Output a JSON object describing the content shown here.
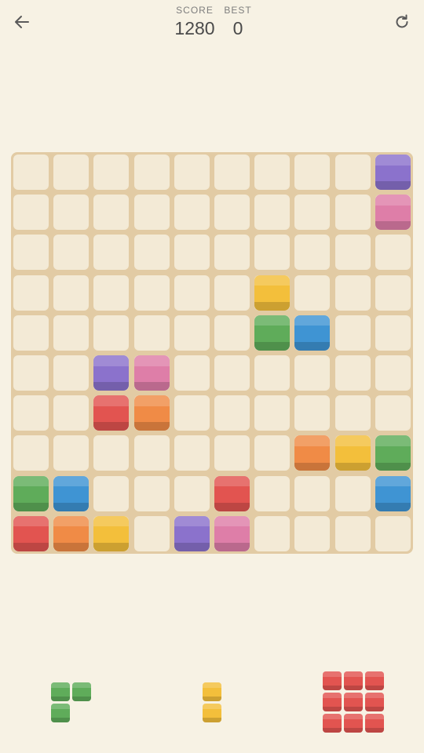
{
  "header": {
    "back_icon": "arrow-left-icon",
    "restart_icon": "restart-icon",
    "score_label": "SCORE",
    "score_value": "1280",
    "best_label": "BEST",
    "best_value": "0"
  },
  "colors": {
    "background": "#f7f2e4",
    "board": "#e2cba4",
    "empty_cell": "#f3ead6",
    "purple": "#8b72cc",
    "pink": "#de7ea8",
    "yellow": "#f3bf3b",
    "green": "#5fac5a",
    "blue": "#3f94d3",
    "red": "#e25450",
    "orange": "#f08b46"
  },
  "board": {
    "rows": 10,
    "cols": 10,
    "blocks": [
      {
        "row": 0,
        "col": 9,
        "color": "purple"
      },
      {
        "row": 1,
        "col": 9,
        "color": "pink"
      },
      {
        "row": 3,
        "col": 6,
        "color": "yellow"
      },
      {
        "row": 4,
        "col": 6,
        "color": "green"
      },
      {
        "row": 4,
        "col": 7,
        "color": "blue"
      },
      {
        "row": 5,
        "col": 2,
        "color": "purple"
      },
      {
        "row": 5,
        "col": 3,
        "color": "pink"
      },
      {
        "row": 6,
        "col": 2,
        "color": "red"
      },
      {
        "row": 6,
        "col": 3,
        "color": "orange"
      },
      {
        "row": 7,
        "col": 7,
        "color": "orange"
      },
      {
        "row": 7,
        "col": 8,
        "color": "yellow"
      },
      {
        "row": 7,
        "col": 9,
        "color": "green"
      },
      {
        "row": 8,
        "col": 0,
        "color": "green"
      },
      {
        "row": 8,
        "col": 1,
        "color": "blue"
      },
      {
        "row": 8,
        "col": 5,
        "color": "red"
      },
      {
        "row": 8,
        "col": 9,
        "color": "blue"
      },
      {
        "row": 9,
        "col": 0,
        "color": "red"
      },
      {
        "row": 9,
        "col": 1,
        "color": "orange"
      },
      {
        "row": 9,
        "col": 2,
        "color": "yellow"
      },
      {
        "row": 9,
        "col": 4,
        "color": "purple"
      },
      {
        "row": 9,
        "col": 5,
        "color": "pink"
      }
    ]
  },
  "tray": {
    "pieces": [
      {
        "name": "l-corner-piece",
        "color": "green",
        "cells": [
          [
            0,
            0
          ],
          [
            0,
            1
          ],
          [
            1,
            0
          ]
        ]
      },
      {
        "name": "vertical-domino-piece",
        "color": "yellow",
        "cells": [
          [
            0,
            0
          ],
          [
            1,
            0
          ]
        ]
      },
      {
        "name": "square-3x3-piece",
        "color": "red",
        "cells": [
          [
            0,
            0
          ],
          [
            0,
            1
          ],
          [
            0,
            2
          ],
          [
            1,
            0
          ],
          [
            1,
            1
          ],
          [
            1,
            2
          ],
          [
            2,
            0
          ],
          [
            2,
            1
          ],
          [
            2,
            2
          ]
        ]
      }
    ]
  }
}
